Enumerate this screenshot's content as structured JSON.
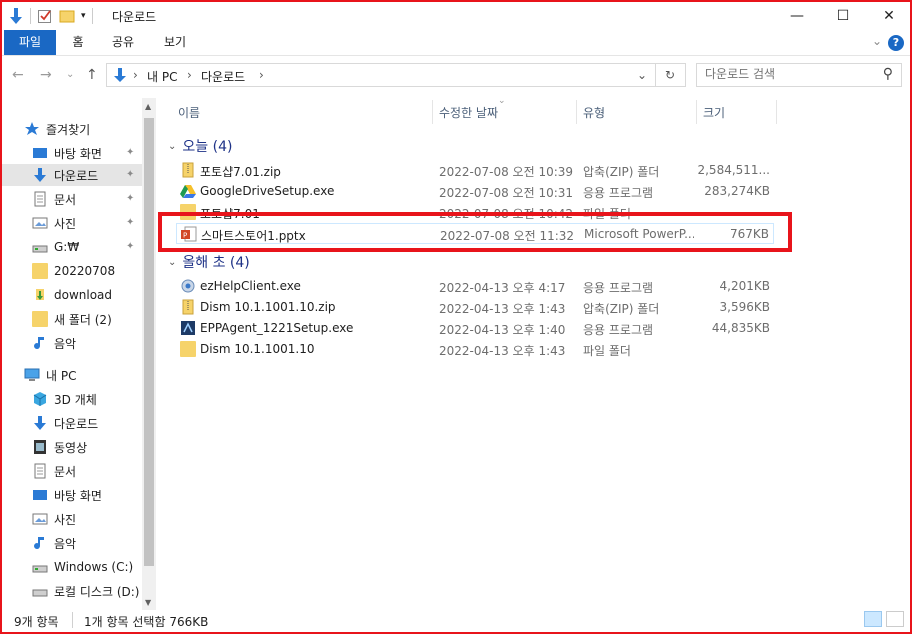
{
  "window": {
    "title": "다운로드",
    "minimize": "—",
    "maximize": "☐",
    "close": "✕"
  },
  "ribbon": {
    "tabs": [
      "파일",
      "홈",
      "공유",
      "보기"
    ],
    "expand": "⌄",
    "help": "?"
  },
  "nav": {
    "back": "←",
    "forward": "→",
    "recent": "⌄",
    "up": "↑",
    "breadcrumb": [
      "내 PC",
      "다운로드"
    ],
    "sep": "›",
    "dropdown": "⌄",
    "refresh": "↻",
    "search_placeholder": "다운로드 검색",
    "search_icon": "⚲"
  },
  "sidebar": {
    "items": [
      {
        "label": "즐겨찾기",
        "icon": "star-icon",
        "pinned": false
      },
      {
        "label": "바탕 화면",
        "icon": "desktop-icon",
        "pinned": true
      },
      {
        "label": "다운로드",
        "icon": "download-icon",
        "pinned": true,
        "selected": true
      },
      {
        "label": "문서",
        "icon": "document-icon",
        "pinned": true
      },
      {
        "label": "사진",
        "icon": "pictures-icon",
        "pinned": true
      },
      {
        "label": "G:₩",
        "icon": "drive-icon",
        "pinned": true
      },
      {
        "label": "20220708",
        "icon": "folder-icon",
        "pinned": false
      },
      {
        "label": "download",
        "icon": "folder-icon",
        "pinned": false
      },
      {
        "label": "새 폴더 (2)",
        "icon": "folder-icon",
        "pinned": false
      },
      {
        "label": "음악",
        "icon": "music-icon",
        "pinned": false
      },
      {
        "label": "내 PC",
        "icon": "pc-icon",
        "pinned": false
      },
      {
        "label": "3D 개체",
        "icon": "3d-objects-icon",
        "pinned": false
      },
      {
        "label": "다운로드",
        "icon": "download-icon",
        "pinned": false
      },
      {
        "label": "동영상",
        "icon": "video-icon",
        "pinned": false
      },
      {
        "label": "문서",
        "icon": "document-icon",
        "pinned": false
      },
      {
        "label": "바탕 화면",
        "icon": "desktop-icon",
        "pinned": false
      },
      {
        "label": "사진",
        "icon": "pictures-icon",
        "pinned": false
      },
      {
        "label": "음악",
        "icon": "music-icon",
        "pinned": false
      },
      {
        "label": "Windows (C:)",
        "icon": "drive-icon",
        "pinned": false
      },
      {
        "label": "로컬 디스크 (D:)",
        "icon": "drive-icon",
        "pinned": false
      }
    ],
    "pin_glyph": "📌"
  },
  "columns": {
    "name": "이름",
    "date": "수정한 날짜",
    "type": "유형",
    "size": "크기"
  },
  "groups": [
    {
      "label": "오늘 (4)"
    },
    {
      "label": "올해 초 (4)"
    }
  ],
  "files": [
    {
      "name": "포토샵7.01.zip",
      "date": "2022-07-08 오전 10:39",
      "type": "압축(ZIP) 폴더",
      "size": "2,584,511...",
      "icon": "zip-icon"
    },
    {
      "name": "GoogleDriveSetup.exe",
      "date": "2022-07-08 오전 10:31",
      "type": "응용 프로그램",
      "size": "283,274KB",
      "icon": "google-drive-icon"
    },
    {
      "name": "포토샵7.01",
      "date": "2022-07-08 오전 10:42",
      "type": "파일 폴더",
      "size": "",
      "icon": "folder-icon"
    },
    {
      "name": "스마트스토어1.pptx",
      "date": "2022-07-08 오전 11:32",
      "type": "Microsoft PowerP...",
      "size": "767KB",
      "icon": "powerpoint-icon"
    },
    {
      "name": "ezHelpClient.exe",
      "date": "2022-04-13 오후 4:17",
      "type": "응용 프로그램",
      "size": "4,201KB",
      "icon": "exe-icon"
    },
    {
      "name": "Dism  10.1.1001.10.zip",
      "date": "2022-04-13 오후 1:43",
      "type": "압축(ZIP) 폴더",
      "size": "3,596KB",
      "icon": "zip-icon"
    },
    {
      "name": "EPPAgent_1221Setup.exe",
      "date": "2022-04-13 오후 1:40",
      "type": "응용 프로그램",
      "size": "44,835KB",
      "icon": "exe-icon"
    },
    {
      "name": "Dism  10.1.1001.10",
      "date": "2022-04-13 오후 1:43",
      "type": "파일 폴더",
      "size": "",
      "icon": "folder-icon"
    }
  ],
  "status": {
    "count": "9개 항목",
    "selection": "1개 항목 선택함 766KB"
  },
  "colors": {
    "accent": "#1a68c4",
    "highlight_box": "#e8141b",
    "group_text": "#1e3287"
  }
}
